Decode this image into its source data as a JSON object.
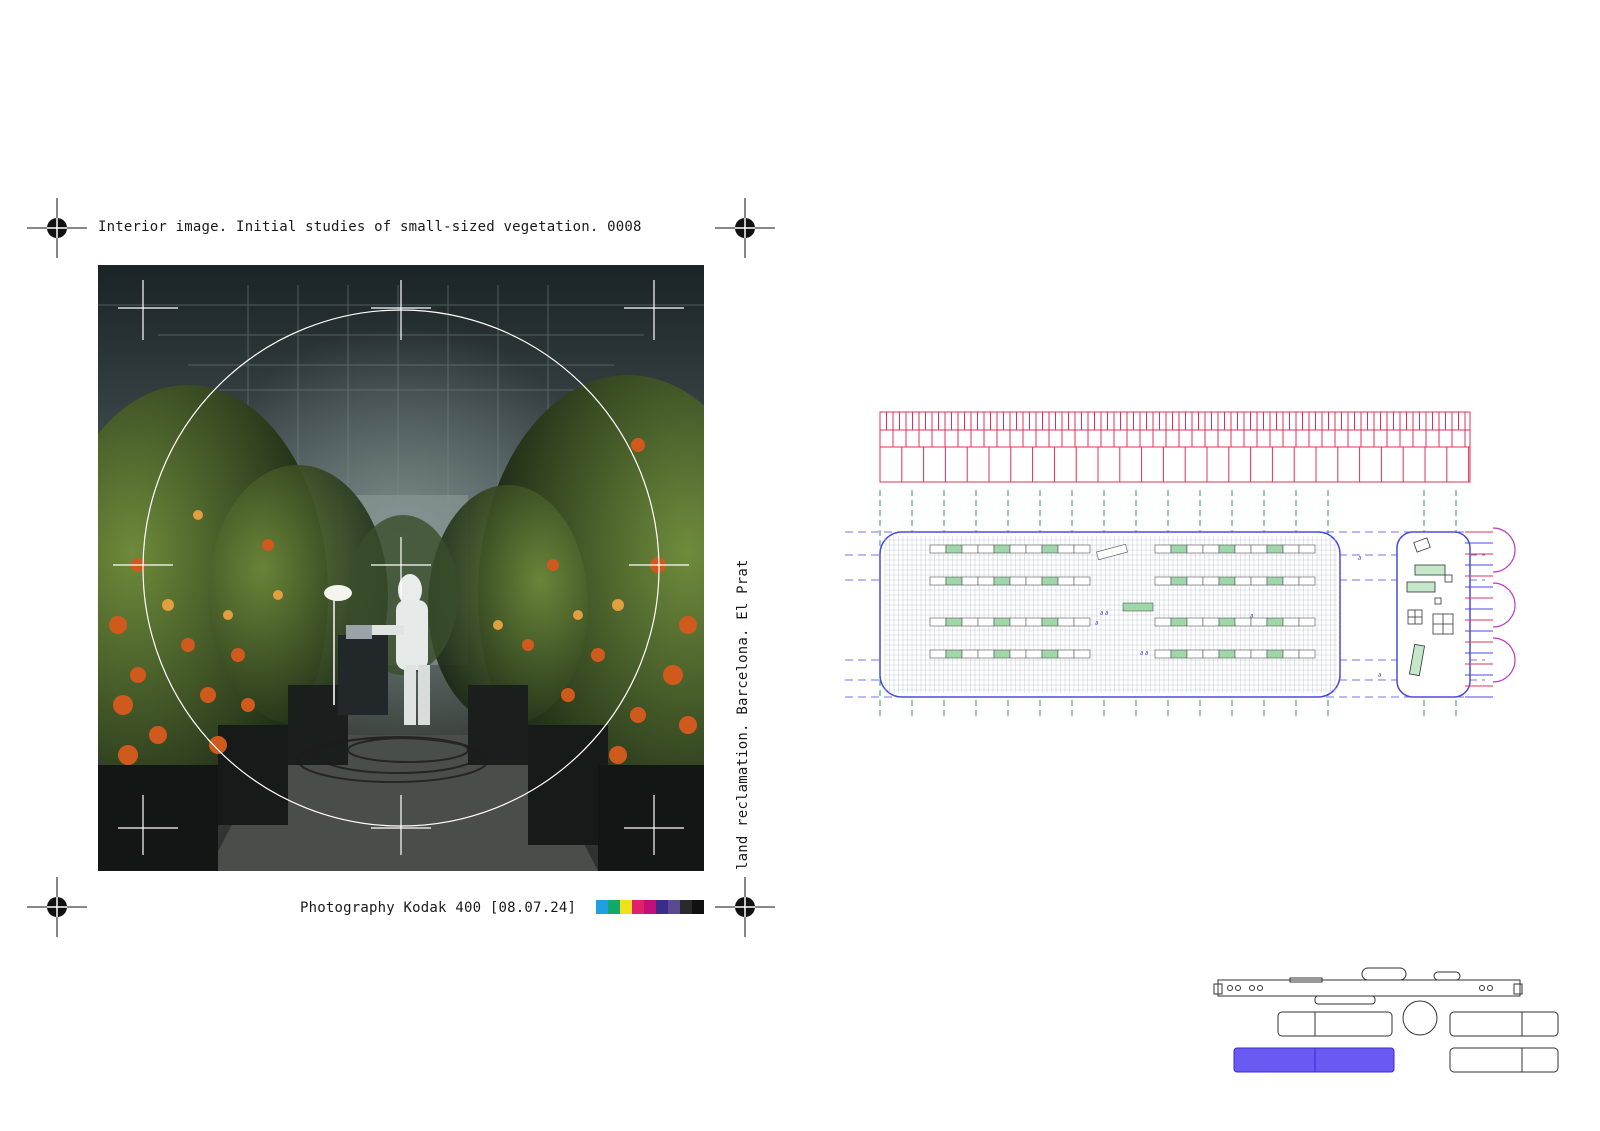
{
  "captions": {
    "top": "Interior image. Initial studies of small-sized vegetation. 0008",
    "bottom": "Photography Kodak 400 [08.07.24]",
    "side": "land reclamation. Barcelona. El Prat"
  },
  "color_swatches": [
    "#1fa0e0",
    "#11a86a",
    "#f0e020",
    "#e0206a",
    "#c0107a",
    "#3a2c8a",
    "#5b4a90",
    "#2a2a2a",
    "#111111"
  ],
  "colors": {
    "elevation_lines": "#e0305a",
    "grid_blue": "#4a4ae0",
    "axis_green": "#2a9a5a",
    "plan_green": "#9ed8a8",
    "fan_magenta": "#c040c0",
    "highlight_block": "#6a5af2"
  },
  "icons": {
    "registration_mark": "registration-target-icon"
  }
}
